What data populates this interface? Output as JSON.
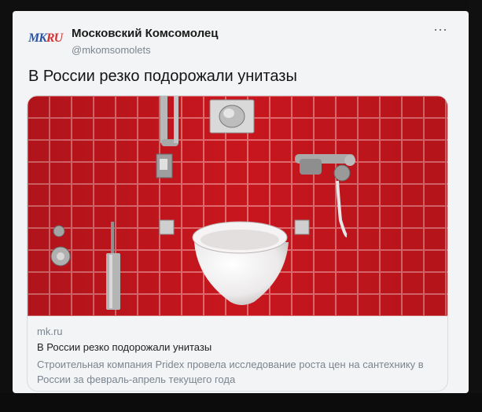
{
  "account": {
    "logo_text_main": "MK",
    "logo_text_accent": "RU",
    "display_name": "Московский Комсомолец",
    "handle": "@mkomsomolets"
  },
  "menu": {
    "more_glyph": "···"
  },
  "tweet": {
    "text": "В России резко подорожали унитазы"
  },
  "link_card": {
    "domain": "mk.ru",
    "title": "В России резко подорожали унитазы",
    "description": "Строительная компания Pridex провела исследование роста цен на сантехнику в России за февраль-апрель текущего года"
  },
  "colors": {
    "tile_red": "#c8161e",
    "grout": "#e26a6e",
    "card_bg": "#f3f4f5",
    "secondary_text": "#7b8590"
  }
}
